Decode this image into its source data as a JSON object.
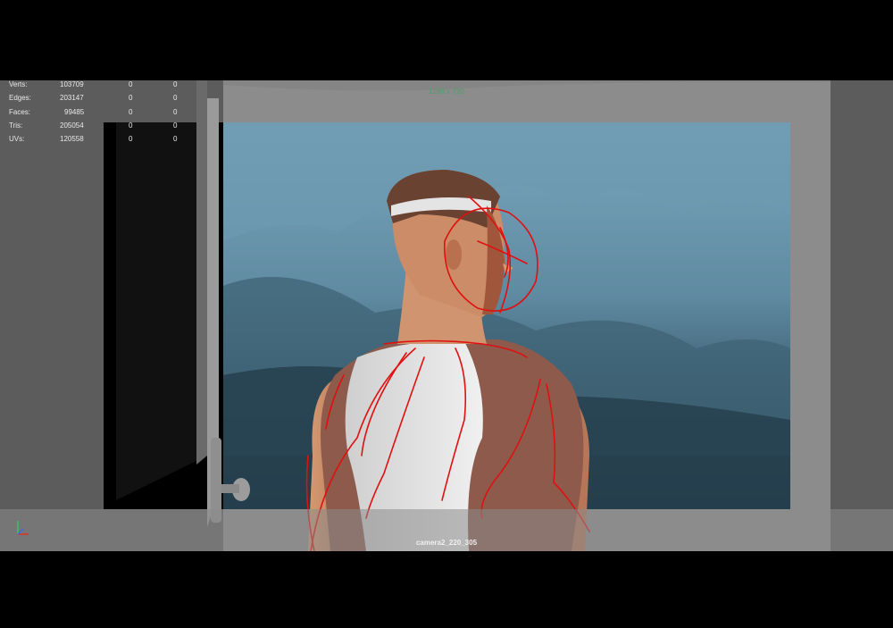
{
  "heads_up_display": {
    "poly_stats": [
      {
        "label": "Verts:",
        "value": "103709",
        "selected": "0",
        "uv_selected": "0"
      },
      {
        "label": "Edges:",
        "value": "203147",
        "selected": "0",
        "uv_selected": "0"
      },
      {
        "label": "Faces:",
        "value": "99485",
        "selected": "0",
        "uv_selected": "0"
      },
      {
        "label": "Tris:",
        "value": "205054",
        "selected": "0",
        "uv_selected": "0"
      },
      {
        "label": "UVs:",
        "value": "120558",
        "selected": "0",
        "uv_selected": "0"
      }
    ],
    "resolution_gate": "1280 x 720",
    "camera_name": "camera2_220_305"
  },
  "colors": {
    "sky": "#6f9ab0",
    "wall": "#4e7388",
    "gate_overlay": "#8a8a8a",
    "annotation_stroke": "#e01010",
    "skin": "#c9845f",
    "hair": "#6a4232",
    "shirt": "#dcdcdc",
    "sleeve": "#8a5448"
  },
  "icons": {
    "axis_indicator": "xyz-axis-icon",
    "door_knob": "door-knob-icon"
  }
}
